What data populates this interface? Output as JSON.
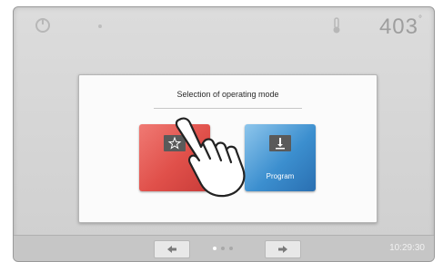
{
  "topbar": {
    "temperature_value": "403",
    "temperature_unit": "°"
  },
  "dialog": {
    "title": "Selection of operating mode",
    "buttons": [
      {
        "name": "favorites",
        "label": "",
        "icon": "star-icon",
        "color": "#e0504a"
      },
      {
        "name": "program",
        "label": "Program",
        "icon": "program-icon",
        "color": "#3c8fcf"
      }
    ]
  },
  "bottombar": {
    "clock": "10:29:30",
    "page_dots": {
      "count": 3,
      "active_index": 0
    }
  },
  "icons": {
    "top_left": "power-icon",
    "top_center": "dot-icon",
    "top_right": "thermometer-icon",
    "nav_prev": "arrow-left-icon",
    "nav_next": "arrow-right-icon",
    "pointer": "hand-pointer-icon"
  }
}
